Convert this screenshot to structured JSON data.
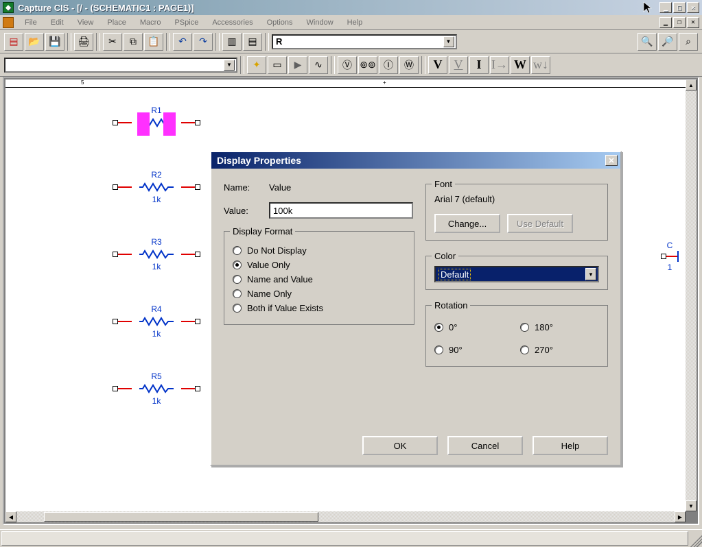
{
  "titlebar": {
    "title": "Capture CIS - [/ - (SCHEMATIC1 : PAGE1)]",
    "minimize": "_",
    "maximize": "□",
    "close": "×"
  },
  "menu": {
    "items": [
      "File",
      "Edit",
      "View",
      "Place",
      "Macro",
      "PSpice",
      "Accessories",
      "Options",
      "Window",
      "Help"
    ]
  },
  "toolbar1": {
    "part_combo": "R"
  },
  "schematic": {
    "r1": {
      "ref": "R1",
      "val": ""
    },
    "r2": {
      "ref": "R2",
      "val": "1k"
    },
    "r3": {
      "ref": "R3",
      "val": "1k"
    },
    "r4": {
      "ref": "R4",
      "val": "1k"
    },
    "r5": {
      "ref": "R5",
      "val": "1k"
    },
    "cap": {
      "ref": "C",
      "val": "1"
    },
    "ruler_5": "5",
    "ruler_mid": "+"
  },
  "dialog": {
    "title": "Display Properties",
    "name_label": "Name:",
    "name_value": "Value",
    "value_label": "Value:",
    "value_input": "100k",
    "display_legend": "Display Format",
    "opts": {
      "do_not": "Do Not Display",
      "value_only": "Value Only",
      "name_value": "Name and Value",
      "name_only": "Name Only",
      "both": "Both if Value Exists"
    },
    "font_legend": "Font",
    "font_value": "Arial 7 (default)",
    "change_btn": "Change...",
    "use_default_btn": "Use Default",
    "color_legend": "Color",
    "color_value": "Default",
    "rotation_legend": "Rotation",
    "rot0": "0°",
    "rot90": "90°",
    "rot180": "180°",
    "rot270": "270°",
    "ok": "OK",
    "cancel": "Cancel",
    "help": "Help"
  }
}
